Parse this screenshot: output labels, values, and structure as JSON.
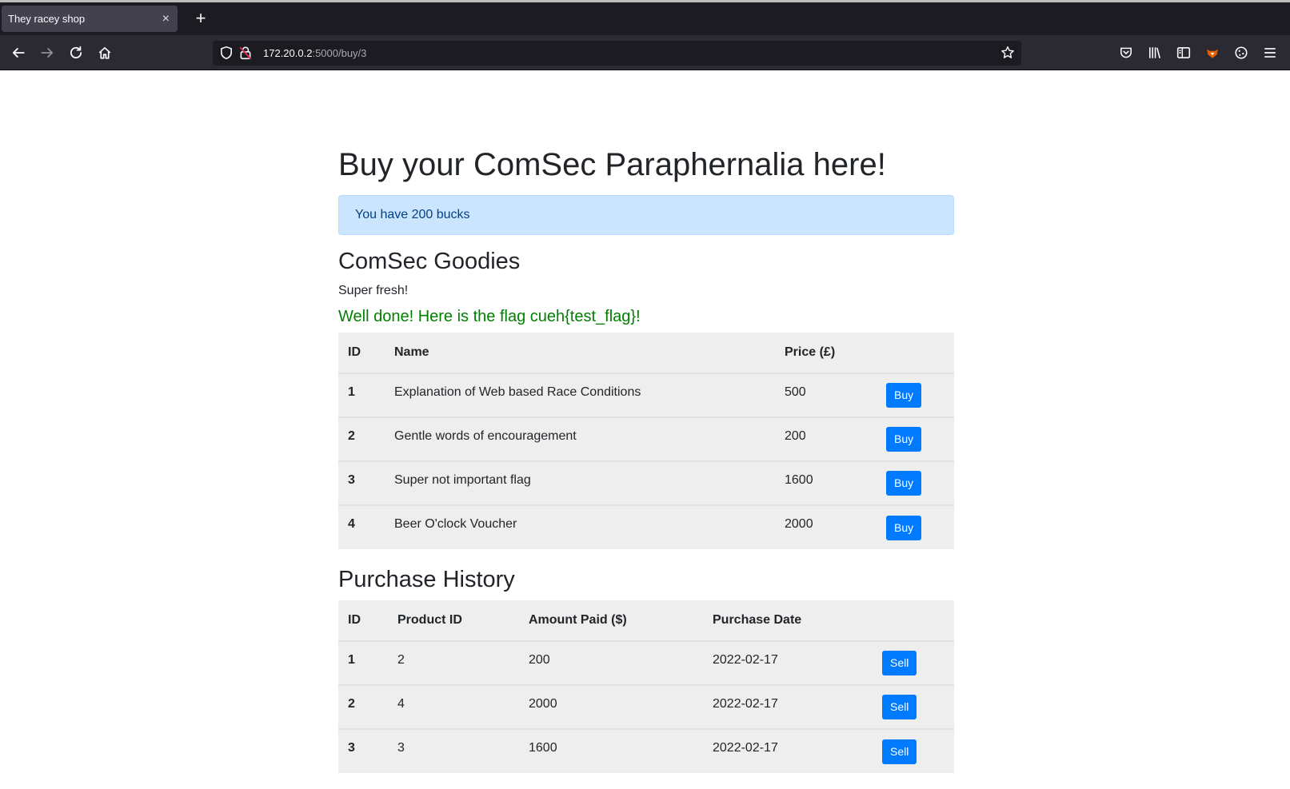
{
  "browser": {
    "tab_title": "They racey shop",
    "tab_close": "×",
    "new_tab": "+",
    "url_host": "172.20.0.2",
    "url_rest": ":5000/buy/3"
  },
  "page": {
    "title": "Buy your ComSec Paraphernalia here!",
    "balance": "You have 200 bucks",
    "goodies_heading": "ComSec Goodies",
    "goodies_subtitle": "Super fresh!",
    "flag_message": "Well done! Here is the flag cueh{test_flag}!",
    "history_heading": "Purchase History"
  },
  "products": {
    "headers": {
      "id": "ID",
      "name": "Name",
      "price": "Price (£)"
    },
    "buy_label": "Buy",
    "rows": [
      {
        "id": "1",
        "name": "Explanation of Web based Race Conditions",
        "price": "500"
      },
      {
        "id": "2",
        "name": "Gentle words of encouragement",
        "price": "200"
      },
      {
        "id": "3",
        "name": "Super not important flag",
        "price": "1600"
      },
      {
        "id": "4",
        "name": "Beer O'clock Voucher",
        "price": "2000"
      }
    ]
  },
  "history": {
    "headers": {
      "id": "ID",
      "product_id": "Product ID",
      "amount": "Amount Paid ($)",
      "date": "Purchase Date"
    },
    "sell_label": "Sell",
    "rows": [
      {
        "id": "1",
        "product_id": "2",
        "amount": "200",
        "date": "2022-02-17"
      },
      {
        "id": "2",
        "product_id": "4",
        "amount": "2000",
        "date": "2022-02-17"
      },
      {
        "id": "3",
        "product_id": "3",
        "amount": "1600",
        "date": "2022-02-17"
      }
    ]
  },
  "colors": {
    "alert_bg": "#cce5ff",
    "alert_text": "#004085",
    "flag_text": "#008000",
    "button": "#007bff",
    "table_bg": "#eeeeee"
  }
}
